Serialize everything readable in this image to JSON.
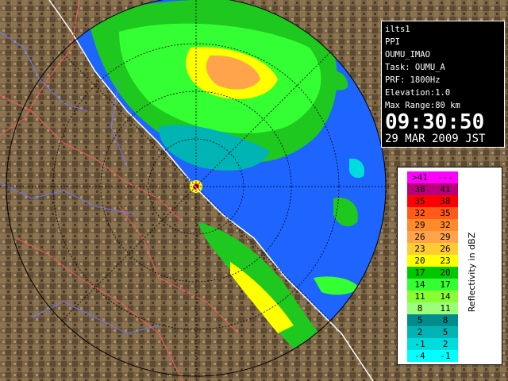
{
  "info": {
    "site": "ilts1",
    "product": "PPI",
    "name": "OUMU_IMAO",
    "task": "Task: OUMU_A",
    "prf": "PRF: 1800Hz",
    "elevation": "Elevation:1.0",
    "max_range": "Max Range:80 km",
    "time": "09:30:50",
    "date": "29 MAR 2009 JST"
  },
  "legend": {
    "unit": "Reflectivity in dBZ",
    "rows": [
      {
        "low": ">41",
        "high": "---",
        "color": "#ff00ff"
      },
      {
        "low": "38",
        "high": "41",
        "color": "#b8007a"
      },
      {
        "low": "35",
        "high": "38",
        "color": "#ff0000"
      },
      {
        "low": "32",
        "high": "35",
        "color": "#ff5a1a"
      },
      {
        "low": "29",
        "high": "32",
        "color": "#ff8a2a"
      },
      {
        "low": "26",
        "high": "29",
        "color": "#ffa44a"
      },
      {
        "low": "23",
        "high": "26",
        "color": "#ffcd33"
      },
      {
        "low": "20",
        "high": "23",
        "color": "#ffff00"
      },
      {
        "low": "17",
        "high": "20",
        "color": "#00c800"
      },
      {
        "low": "14",
        "high": "17",
        "color": "#33ff33"
      },
      {
        "low": "11",
        "high": "14",
        "color": "#88ff33"
      },
      {
        "low": "8",
        "high": "11",
        "color": "#9cff7a"
      },
      {
        "low": "5",
        "high": "8",
        "color": "#008c8c"
      },
      {
        "low": "2",
        "high": "5",
        "color": "#00b4b4"
      },
      {
        "low": "-1",
        "high": "2",
        "color": "#00dcdc"
      },
      {
        "low": "-4",
        "high": "-1",
        "color": "#00ffff"
      }
    ]
  },
  "colors": {
    "background": "#000000",
    "terrain": "#7a6445",
    "range_circle_fill": "#1e64ff",
    "coastline": "#ffffff",
    "prefecture_border": "#ff5a5a",
    "river": "#6e7aff"
  }
}
